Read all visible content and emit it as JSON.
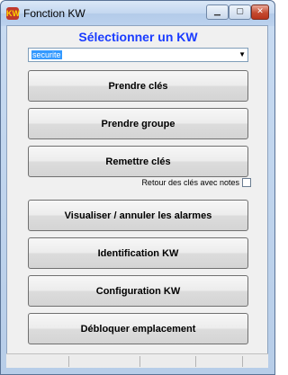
{
  "window": {
    "title": "Fonction KW",
    "app_icon_text": "KW"
  },
  "heading": "Sélectionner un KW",
  "selector": {
    "value": "securite"
  },
  "buttons": {
    "prendre_cles": "Prendre clés",
    "prendre_groupe": "Prendre groupe",
    "remettre_cles": "Remettre clés",
    "visualiser_alarmes": "Visualiser / annuler les alarmes",
    "identification": "Identification KW",
    "configuration": "Configuration KW",
    "debloquer": "Débloquer emplacement"
  },
  "notes_checkbox": {
    "label": "Retour des clés avec notes",
    "checked": false
  },
  "colors": {
    "heading": "#1a3cff",
    "selection": "#3399ff"
  }
}
